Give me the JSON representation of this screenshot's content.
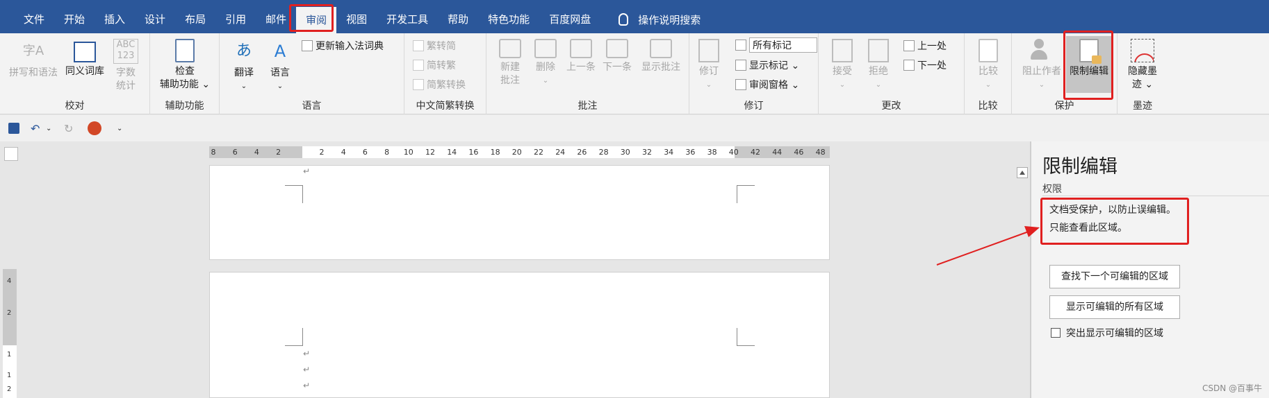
{
  "menu": {
    "tabs": [
      "文件",
      "开始",
      "插入",
      "设计",
      "布局",
      "引用",
      "邮件",
      "审阅",
      "视图",
      "开发工具",
      "帮助",
      "特色功能",
      "百度网盘"
    ],
    "active_tab": "审阅",
    "search_label": "操作说明搜索"
  },
  "ribbon": {
    "groups": {
      "proof": {
        "label": "校对",
        "spell": "拼写和语法",
        "thesaurus": "同义词库",
        "count_icon": "ABC\n123",
        "count_l1": "字数",
        "count_l2": "统计",
        "spell_icon": "字A"
      },
      "access": {
        "label": "辅助功能",
        "check_l1": "检查",
        "check_l2": "辅助功能 ⌄"
      },
      "lang": {
        "label": "语言",
        "translate": "翻译",
        "language": "语言",
        "ime": "更新输入法词典"
      },
      "chinese": {
        "label": "中文简繁转换",
        "to_trad": "繁转简",
        "to_simp": "简转繁",
        "convert": "简繁转换"
      },
      "comments": {
        "label": "批注",
        "new_l1": "新建",
        "new_l2": "批注",
        "delete": "删除",
        "prev": "上一条",
        "next": "下一条",
        "show": "显示批注"
      },
      "tracking": {
        "label": "修订",
        "track": "修订",
        "dropdown_value": "所有标记",
        "show_markup": "显示标记 ⌄",
        "review_pane": "审阅窗格 ⌄"
      },
      "changes": {
        "label": "更改",
        "accept": "接受",
        "reject": "拒绝",
        "prev": "上一处",
        "next": "下一处"
      },
      "compare": {
        "label": "比较",
        "compare": "比较"
      },
      "protect": {
        "label": "保护",
        "block": "阻止作者",
        "restrict": "限制编辑"
      },
      "ink": {
        "label": "墨迹",
        "hide_l1": "隐藏墨",
        "hide_l2": "迹 ⌄"
      }
    }
  },
  "ruler": {
    "numbers": [
      "8",
      "6",
      "4",
      "2",
      "",
      "2",
      "4",
      "6",
      "8",
      "10",
      "12",
      "14",
      "16",
      "18",
      "20",
      "22",
      "24",
      "26",
      "28",
      "30",
      "32",
      "34",
      "36",
      "38",
      "40",
      "42",
      "44",
      "46",
      "48"
    ]
  },
  "vruler": {
    "numbers": [
      "4",
      "2",
      "1",
      "1",
      "2"
    ]
  },
  "paragraph_mark": "↵",
  "pane": {
    "title": "限制编辑",
    "section": "权限",
    "msg1": "文档受保护，以防止误编辑。",
    "msg2": "只能查看此区域。",
    "btn_find": "查找下一个可编辑的区域",
    "btn_show": "显示可编辑的所有区域",
    "highlight": "突出显示可编辑的区域"
  },
  "watermark": "CSDN @百事牛",
  "colors": {
    "accent": "#2b579a",
    "annotation_red": "#e02020"
  }
}
